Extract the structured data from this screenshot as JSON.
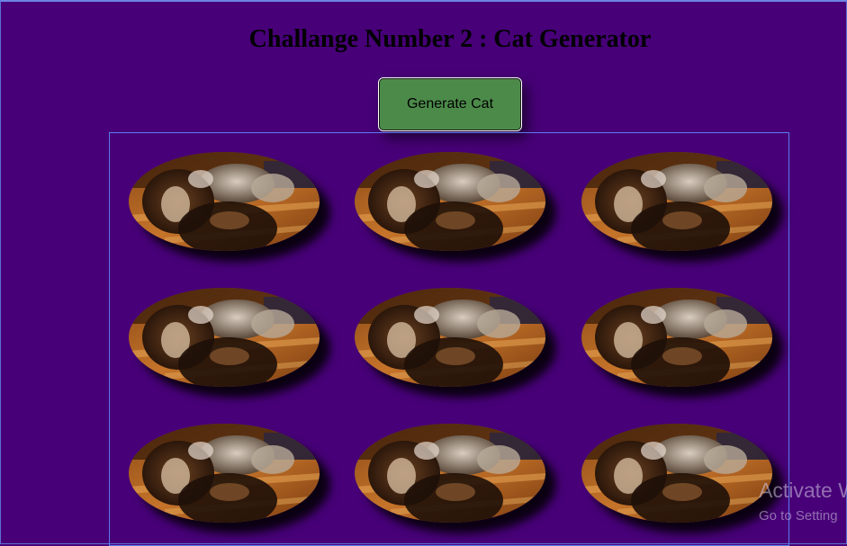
{
  "page": {
    "title": "Challange Number 2 : Cat Generator",
    "background": "#470078"
  },
  "controls": {
    "generate_label": "Generate Cat",
    "button_color": "#4c8a4a"
  },
  "cats": {
    "rows": 3,
    "columns": 3,
    "count": 9,
    "image_subject": "animated dog puppies gif (image only, no visible text)"
  },
  "watermark": {
    "title": "Activate W",
    "subtitle": "Go to Setting"
  }
}
